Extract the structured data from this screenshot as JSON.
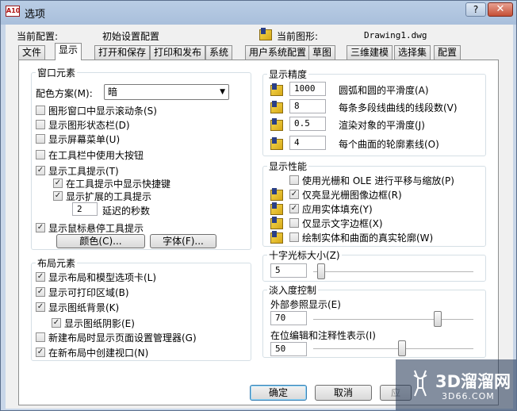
{
  "window": {
    "title": "选项",
    "app_icon_text": "A10",
    "help_glyph": "?",
    "close_glyph": "✕"
  },
  "header": {
    "current_profile_label": "当前配置:",
    "current_profile_value": "初始设置配置",
    "current_drawing_label": "当前图形:",
    "current_drawing_value": "Drawing1.dwg"
  },
  "tabs": [
    "文件",
    "显示",
    "打开和保存",
    "打印和发布",
    "系统",
    "用户系统配置",
    "草图",
    "三维建模",
    "选择集",
    "配置"
  ],
  "active_tab": "显示",
  "window_elements": {
    "title": "窗口元素",
    "color_scheme_label": "配色方案(M):",
    "color_scheme_value": "暗",
    "checks": [
      {
        "label": "图形窗口中显示滚动条(S)",
        "checked": false
      },
      {
        "label": "显示图形状态栏(D)",
        "checked": false
      },
      {
        "label": "显示屏幕菜单(U)",
        "checked": false
      },
      {
        "label": "在工具栏中使用大按钮",
        "checked": false
      },
      {
        "label": "显示工具提示(T)",
        "checked": true
      },
      {
        "label": "在工具提示中显示快捷键",
        "checked": true
      },
      {
        "label": "显示扩展的工具提示",
        "checked": true
      }
    ],
    "delay_value": "2",
    "delay_label": "延迟的秒数",
    "hover_tooltip_label": "显示鼠标悬停工具提示",
    "hover_tooltip_checked": true,
    "colors_button": "颜色(C)...",
    "fonts_button": "字体(F)..."
  },
  "layout_elements": {
    "title": "布局元素",
    "checks": [
      {
        "label": "显示布局和模型选项卡(L)",
        "checked": true
      },
      {
        "label": "显示可打印区域(B)",
        "checked": true
      },
      {
        "label": "显示图纸背景(K)",
        "checked": true
      },
      {
        "label": "显示图纸阴影(E)",
        "checked": true
      },
      {
        "label": "新建布局时显示页面设置管理器(G)",
        "checked": false
      },
      {
        "label": "在新布局中创建视口(N)",
        "checked": true
      }
    ]
  },
  "resolution": {
    "title": "显示精度",
    "rows": [
      {
        "value": "1000",
        "label": "圆弧和圆的平滑度(A)"
      },
      {
        "value": "8",
        "label": "每条多段线曲线的线段数(V)"
      },
      {
        "value": "0.5",
        "label": "渲染对象的平滑度(J)"
      },
      {
        "value": "4",
        "label": "每个曲面的轮廓素线(O)"
      }
    ]
  },
  "performance": {
    "title": "显示性能",
    "checks": [
      {
        "label": "使用光栅和 OLE 进行平移与缩放(P)",
        "checked": false,
        "icon": false
      },
      {
        "label": "仅亮显光栅图像边框(R)",
        "checked": true,
        "icon": true
      },
      {
        "label": "应用实体填充(Y)",
        "checked": true,
        "icon": true
      },
      {
        "label": "仅显示文字边框(X)",
        "checked": false,
        "icon": true
      },
      {
        "label": "绘制实体和曲面的真实轮廓(W)",
        "checked": false,
        "icon": true
      }
    ]
  },
  "crosshair": {
    "title": "十字光标大小(Z)",
    "value": "5",
    "level": 5
  },
  "fade": {
    "title": "淡入度控制",
    "xref_label": "外部参照显示(E)",
    "xref_value": "70",
    "xref_level": 70,
    "inplace_label": "在位编辑和注释性表示(I)",
    "inplace_value": "50",
    "inplace_level": 50
  },
  "footer": {
    "ok": "确定",
    "cancel": "取消",
    "apply": "应"
  },
  "watermark": {
    "text": "3D溜溜网",
    "sub": "3D66.COM"
  }
}
